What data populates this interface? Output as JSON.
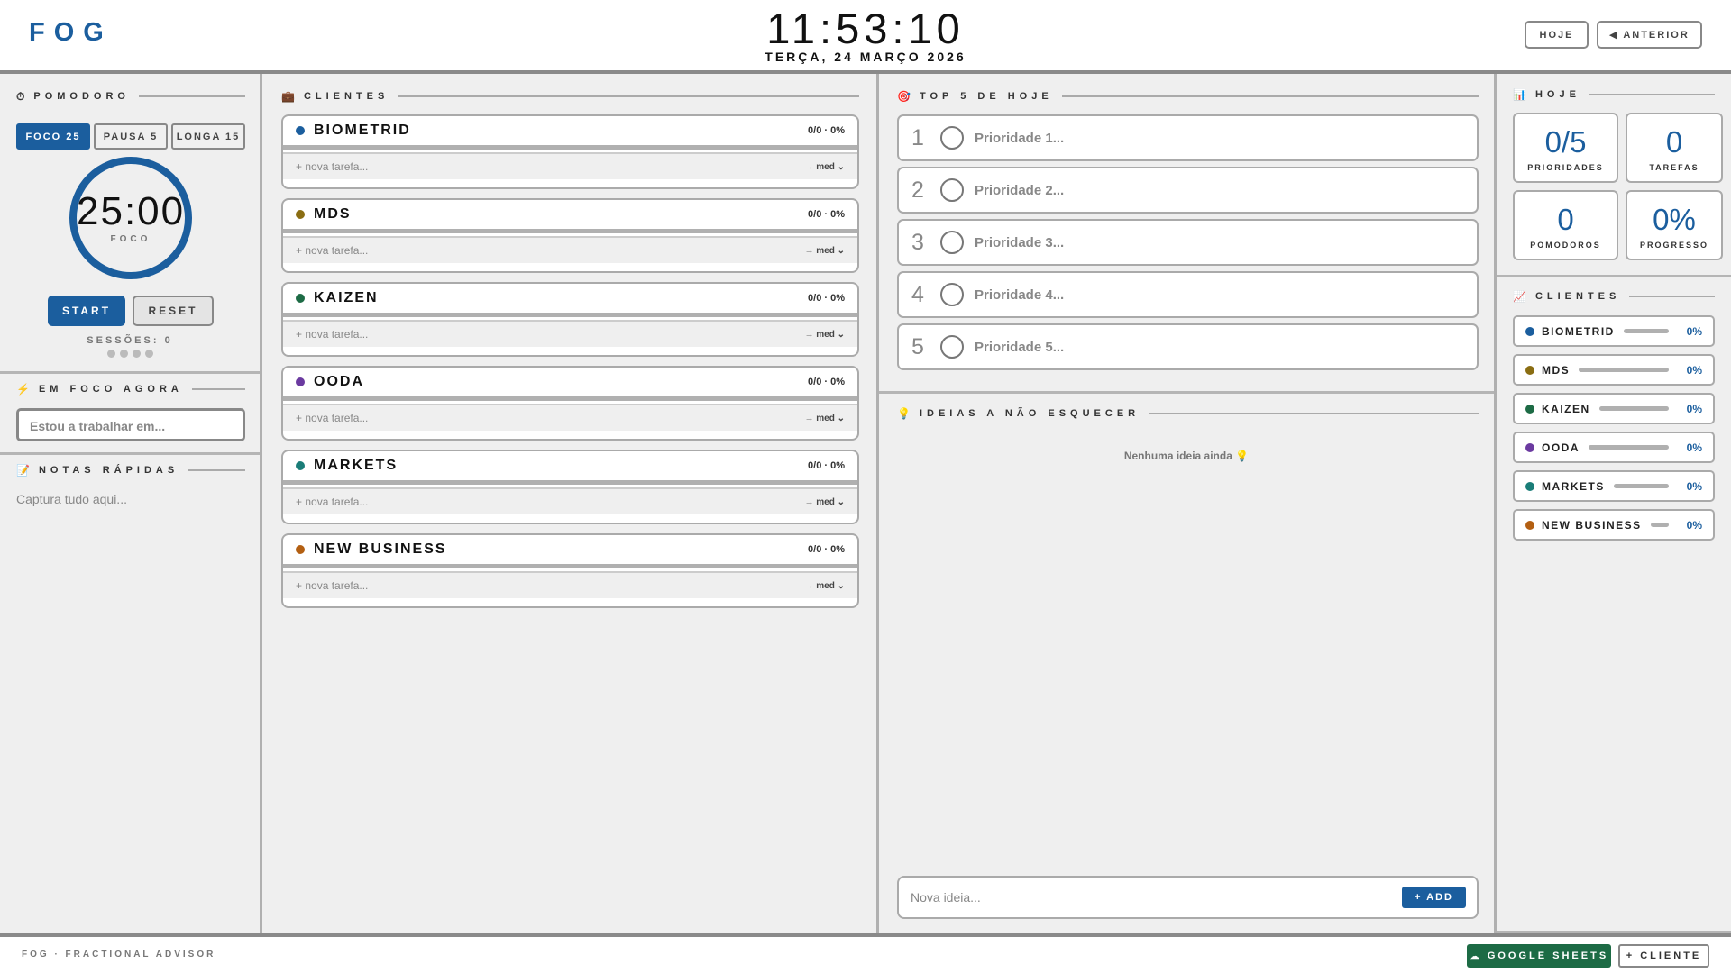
{
  "header": {
    "logo": "FOG",
    "clock": "11:53:10",
    "date": "TERÇA, 24 MARÇO 2026",
    "today_btn": "HOJE",
    "prev_btn": "◀ ANTERIOR"
  },
  "pomodoro": {
    "title": "POMODORO",
    "icon": "⏱",
    "tabs": [
      "FOCO 25",
      "PAUSA 5",
      "LONGA 15"
    ],
    "time": "25:00",
    "mode": "FOCO",
    "start": "START",
    "reset": "RESET",
    "sessions": "SESSÕES: 0",
    "session_dots": 4
  },
  "focus": {
    "title": "EM FOCO AGORA",
    "icon": "⚡",
    "placeholder": "Estou a trabalhar em..."
  },
  "notes": {
    "title": "NOTAS RÁPIDAS",
    "icon": "📝",
    "placeholder": "Captura tudo aqui..."
  },
  "clients": {
    "title": "CLIENTES",
    "icon": "💼",
    "task_placeholder": "+ nova tarefa...",
    "priority": "→ med",
    "items": [
      {
        "name": "BIOMETRID",
        "stats": "0/0 · 0%",
        "color": "#1b5e9e"
      },
      {
        "name": "MDS",
        "stats": "0/0 · 0%",
        "color": "#8a6d12"
      },
      {
        "name": "KAIZEN",
        "stats": "0/0 · 0%",
        "color": "#1d6b45"
      },
      {
        "name": "OODA",
        "stats": "0/0 · 0%",
        "color": "#6b3aa0"
      },
      {
        "name": "MARKETS",
        "stats": "0/0 · 0%",
        "color": "#1a7d78"
      },
      {
        "name": "NEW BUSINESS",
        "stats": "0/0 · 0%",
        "color": "#b35f12"
      }
    ]
  },
  "top5": {
    "title": "TOP 5 DE HOJE",
    "icon": "🎯",
    "items": [
      {
        "n": "1",
        "placeholder": "Prioridade 1..."
      },
      {
        "n": "2",
        "placeholder": "Prioridade 2..."
      },
      {
        "n": "3",
        "placeholder": "Prioridade 3..."
      },
      {
        "n": "4",
        "placeholder": "Prioridade 4..."
      },
      {
        "n": "5",
        "placeholder": "Prioridade 5..."
      }
    ]
  },
  "ideas": {
    "title": "IDEIAS A NÃO ESQUECER",
    "icon": "💡",
    "empty": "Nenhuma ideia ainda 💡",
    "placeholder": "Nova ideia...",
    "add": "+ ADD"
  },
  "today": {
    "title": "HOJE",
    "icon": "📊",
    "stats": [
      {
        "value": "0/5",
        "label": "PRIORIDADES"
      },
      {
        "value": "0",
        "label": "TAREFAS"
      },
      {
        "value": "0",
        "label": "POMODOROS"
      },
      {
        "value": "0%",
        "label": "PROGRESSO"
      }
    ]
  },
  "client_progress": {
    "title": "CLIENTES",
    "icon": "📈",
    "items": [
      {
        "name": "BIOMETRID",
        "pct": "0%",
        "progress": 0
      },
      {
        "name": "MDS",
        "pct": "0%",
        "progress": 0
      },
      {
        "name": "KAIZEN",
        "pct": "0%",
        "progress": 0
      },
      {
        "name": "OODA",
        "pct": "0%",
        "progress": 0
      },
      {
        "name": "MARKETS",
        "pct": "0%",
        "progress": 0
      },
      {
        "name": "NEW BUSINESS",
        "pct": "0%",
        "progress": 0
      }
    ]
  },
  "footer": {
    "brand": "FOG · FRACTIONAL ADVISOR",
    "sheets": "GOOGLE SHEETS",
    "sheets_icon": "☁",
    "add_client": "+ CLIENTE"
  }
}
